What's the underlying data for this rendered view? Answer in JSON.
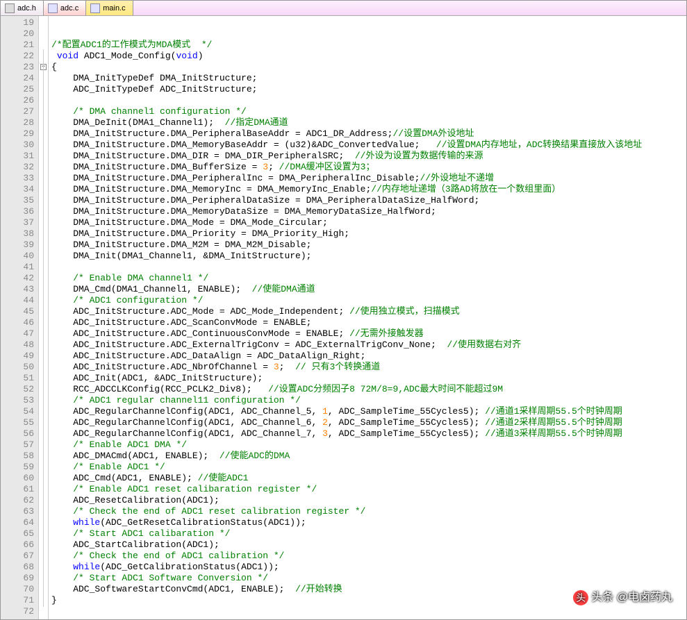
{
  "tabs": [
    {
      "label": "adc.h",
      "icon": "h",
      "active": false,
      "alt": false
    },
    {
      "label": "adc.c",
      "icon": "c",
      "active": true,
      "alt": false
    },
    {
      "label": "main.c",
      "icon": "c",
      "active": false,
      "alt": true
    }
  ],
  "line_start": 19,
  "line_end": 72,
  "fold_at": 23,
  "code": [
    {
      "n": 19,
      "seg": []
    },
    {
      "n": 20,
      "seg": []
    },
    {
      "n": 21,
      "seg": [
        {
          "c": "c-cmt",
          "t": "/*配置ADC1的工作模式为MDA模式  */"
        }
      ]
    },
    {
      "n": 22,
      "seg": [
        {
          "t": " "
        },
        {
          "c": "c-kw",
          "t": "void"
        },
        {
          "t": " ADC1_Mode_Config("
        },
        {
          "c": "c-kw",
          "t": "void"
        },
        {
          "t": ")"
        }
      ]
    },
    {
      "n": 23,
      "seg": [
        {
          "t": "{"
        }
      ]
    },
    {
      "n": 24,
      "seg": [
        {
          "t": "    DMA_InitTypeDef DMA_InitStructure;"
        }
      ]
    },
    {
      "n": 25,
      "seg": [
        {
          "t": "    ADC_InitTypeDef ADC_InitStructure;"
        }
      ]
    },
    {
      "n": 26,
      "seg": []
    },
    {
      "n": 27,
      "seg": [
        {
          "t": "    "
        },
        {
          "c": "c-cmt",
          "t": "/* DMA channel1 configuration */"
        }
      ]
    },
    {
      "n": 28,
      "seg": [
        {
          "t": "    DMA_DeInit(DMA1_Channel1);  "
        },
        {
          "c": "c-cmt",
          "t": "//指定DMA通道"
        }
      ]
    },
    {
      "n": 29,
      "seg": [
        {
          "t": "    DMA_InitStructure.DMA_PeripheralBaseAddr = ADC1_DR_Address;"
        },
        {
          "c": "c-cmt",
          "t": "//设置DMA外设地址"
        }
      ]
    },
    {
      "n": 30,
      "seg": [
        {
          "t": "    DMA_InitStructure.DMA_MemoryBaseAddr = (u32)&ADC_ConvertedValue;   "
        },
        {
          "c": "c-cmt",
          "t": "//设置DMA内存地址，ADC转换结果直接放入该地址"
        }
      ]
    },
    {
      "n": 31,
      "seg": [
        {
          "t": "    DMA_InitStructure.DMA_DIR = DMA_DIR_PeripheralSRC;  "
        },
        {
          "c": "c-cmt",
          "t": "//外设为设置为数据传输的来源"
        }
      ]
    },
    {
      "n": 32,
      "seg": [
        {
          "t": "    DMA_InitStructure.DMA_BufferSize = "
        },
        {
          "c": "c-num",
          "t": "3"
        },
        {
          "t": "; "
        },
        {
          "c": "c-cmt",
          "t": "//DMA缓冲区设置为3；"
        }
      ]
    },
    {
      "n": 33,
      "seg": [
        {
          "t": "    DMA_InitStructure.DMA_PeripheralInc = DMA_PeripheralInc_Disable;"
        },
        {
          "c": "c-cmt",
          "t": "//外设地址不递增"
        }
      ]
    },
    {
      "n": 34,
      "seg": [
        {
          "t": "    DMA_InitStructure.DMA_MemoryInc = DMA_MemoryInc_Enable;"
        },
        {
          "c": "c-cmt",
          "t": "//内存地址递增（3路AD将放在一个数组里面）"
        }
      ]
    },
    {
      "n": 35,
      "seg": [
        {
          "t": "    DMA_InitStructure.DMA_PeripheralDataSize = DMA_PeripheralDataSize_HalfWord;"
        }
      ]
    },
    {
      "n": 36,
      "seg": [
        {
          "t": "    DMA_InitStructure.DMA_MemoryDataSize = DMA_MemoryDataSize_HalfWord;"
        }
      ]
    },
    {
      "n": 37,
      "seg": [
        {
          "t": "    DMA_InitStructure.DMA_Mode = DMA_Mode_Circular;"
        }
      ]
    },
    {
      "n": 38,
      "seg": [
        {
          "t": "    DMA_InitStructure.DMA_Priority = DMA_Priority_High;"
        }
      ]
    },
    {
      "n": 39,
      "seg": [
        {
          "t": "    DMA_InitStructure.DMA_M2M = DMA_M2M_Disable;"
        }
      ]
    },
    {
      "n": 40,
      "seg": [
        {
          "t": "    DMA_Init(DMA1_Channel1, &DMA_InitStructure);"
        }
      ]
    },
    {
      "n": 41,
      "seg": []
    },
    {
      "n": 42,
      "seg": [
        {
          "t": "    "
        },
        {
          "c": "c-cmt",
          "t": "/* Enable DMA channel1 */"
        }
      ]
    },
    {
      "n": 43,
      "seg": [
        {
          "t": "    DMA_Cmd(DMA1_Channel1, ENABLE);  "
        },
        {
          "c": "c-cmt",
          "t": "//使能DMA通道"
        }
      ]
    },
    {
      "n": 44,
      "seg": [
        {
          "t": "    "
        },
        {
          "c": "c-cmt",
          "t": "/* ADC1 configuration */"
        }
      ]
    },
    {
      "n": 45,
      "seg": [
        {
          "t": "    ADC_InitStructure.ADC_Mode = ADC_Mode_Independent; "
        },
        {
          "c": "c-cmt",
          "t": "//使用独立模式，扫描模式"
        }
      ]
    },
    {
      "n": 46,
      "seg": [
        {
          "t": "    ADC_InitStructure.ADC_ScanConvMode = ENABLE;"
        }
      ]
    },
    {
      "n": 47,
      "seg": [
        {
          "t": "    ADC_InitStructure.ADC_ContinuousConvMode = ENABLE; "
        },
        {
          "c": "c-cmt",
          "t": "//无需外接触发器"
        }
      ]
    },
    {
      "n": 48,
      "seg": [
        {
          "t": "    ADC_InitStructure.ADC_ExternalTrigConv = ADC_ExternalTrigConv_None;  "
        },
        {
          "c": "c-cmt",
          "t": "//使用数据右对齐"
        }
      ]
    },
    {
      "n": 49,
      "seg": [
        {
          "t": "    ADC_InitStructure.ADC_DataAlign = ADC_DataAlign_Right;"
        }
      ]
    },
    {
      "n": 50,
      "seg": [
        {
          "t": "    ADC_InitStructure.ADC_NbrOfChannel = "
        },
        {
          "c": "c-num",
          "t": "3"
        },
        {
          "t": ";  "
        },
        {
          "c": "c-cmt",
          "t": "// 只有3个转换通道"
        }
      ]
    },
    {
      "n": 51,
      "seg": [
        {
          "t": "    ADC_Init(ADC1, &ADC_InitStructure);"
        }
      ]
    },
    {
      "n": 52,
      "seg": [
        {
          "t": "    RCC_ADCCLKConfig(RCC_PCLK2_Div8);   "
        },
        {
          "c": "c-cmt",
          "t": "//设置ADC分频因子8 72M/8=9,ADC最大时间不能超过9M"
        }
      ]
    },
    {
      "n": 53,
      "seg": [
        {
          "t": "    "
        },
        {
          "c": "c-cmt",
          "t": "/* ADC1 regular channel11 configuration */"
        }
      ]
    },
    {
      "n": 54,
      "seg": [
        {
          "t": "    ADC_RegularChannelConfig(ADC1, ADC_Channel_5, "
        },
        {
          "c": "c-num",
          "t": "1"
        },
        {
          "t": ", ADC_SampleTime_55Cycles5); "
        },
        {
          "c": "c-cmt",
          "t": "//通道1采样周期55.5个时钟周期"
        }
      ]
    },
    {
      "n": 55,
      "seg": [
        {
          "t": "    ADC_RegularChannelConfig(ADC1, ADC_Channel_6, "
        },
        {
          "c": "c-num",
          "t": "2"
        },
        {
          "t": ", ADC_SampleTime_55Cycles5); "
        },
        {
          "c": "c-cmt",
          "t": "//通道2采样周期55.5个时钟周期"
        }
      ]
    },
    {
      "n": 56,
      "seg": [
        {
          "t": "    ADC_RegularChannelConfig(ADC1, ADC_Channel_7, "
        },
        {
          "c": "c-num",
          "t": "3"
        },
        {
          "t": ", ADC_SampleTime_55Cycles5); "
        },
        {
          "c": "c-cmt",
          "t": "//通道3采样周期55.5个时钟周期"
        }
      ]
    },
    {
      "n": 57,
      "seg": [
        {
          "t": "    "
        },
        {
          "c": "c-cmt",
          "t": "/* Enable ADC1 DMA */"
        }
      ]
    },
    {
      "n": 58,
      "seg": [
        {
          "t": "    ADC_DMACmd(ADC1, ENABLE);  "
        },
        {
          "c": "c-cmt",
          "t": "//使能ADC的DMA"
        }
      ]
    },
    {
      "n": 59,
      "seg": [
        {
          "t": "    "
        },
        {
          "c": "c-cmt",
          "t": "/* Enable ADC1 */"
        }
      ]
    },
    {
      "n": 60,
      "seg": [
        {
          "t": "    ADC_Cmd(ADC1, ENABLE); "
        },
        {
          "c": "c-cmt",
          "t": "//使能ADC1"
        }
      ]
    },
    {
      "n": 61,
      "seg": [
        {
          "t": "    "
        },
        {
          "c": "c-cmt",
          "t": "/* Enable ADC1 reset calibaration register */"
        }
      ]
    },
    {
      "n": 62,
      "seg": [
        {
          "t": "    ADC_ResetCalibration(ADC1);"
        }
      ]
    },
    {
      "n": 63,
      "seg": [
        {
          "t": "    "
        },
        {
          "c": "c-cmt",
          "t": "/* Check the end of ADC1 reset calibration register */"
        }
      ]
    },
    {
      "n": 64,
      "seg": [
        {
          "t": "    "
        },
        {
          "c": "c-kw",
          "t": "while"
        },
        {
          "t": "(ADC_GetResetCalibrationStatus(ADC1));"
        }
      ]
    },
    {
      "n": 65,
      "seg": [
        {
          "t": "    "
        },
        {
          "c": "c-cmt",
          "t": "/* Start ADC1 calibaration */"
        }
      ]
    },
    {
      "n": 66,
      "seg": [
        {
          "t": "    ADC_StartCalibration(ADC1);"
        }
      ]
    },
    {
      "n": 67,
      "seg": [
        {
          "t": "    "
        },
        {
          "c": "c-cmt",
          "t": "/* Check the end of ADC1 calibration */"
        }
      ]
    },
    {
      "n": 68,
      "seg": [
        {
          "t": "    "
        },
        {
          "c": "c-kw",
          "t": "while"
        },
        {
          "t": "(ADC_GetCalibrationStatus(ADC1));"
        }
      ]
    },
    {
      "n": 69,
      "seg": [
        {
          "t": "    "
        },
        {
          "c": "c-cmt",
          "t": "/* Start ADC1 Software Conversion */"
        }
      ]
    },
    {
      "n": 70,
      "seg": [
        {
          "t": "    ADC_SoftwareStartConvCmd(ADC1, ENABLE);  "
        },
        {
          "c": "c-cmt",
          "t": "//开始转换"
        }
      ]
    },
    {
      "n": 71,
      "seg": [
        {
          "t": "}"
        }
      ]
    },
    {
      "n": 72,
      "seg": []
    }
  ],
  "watermark": {
    "prefix": "头条",
    "handle": "@电卤药丸"
  }
}
